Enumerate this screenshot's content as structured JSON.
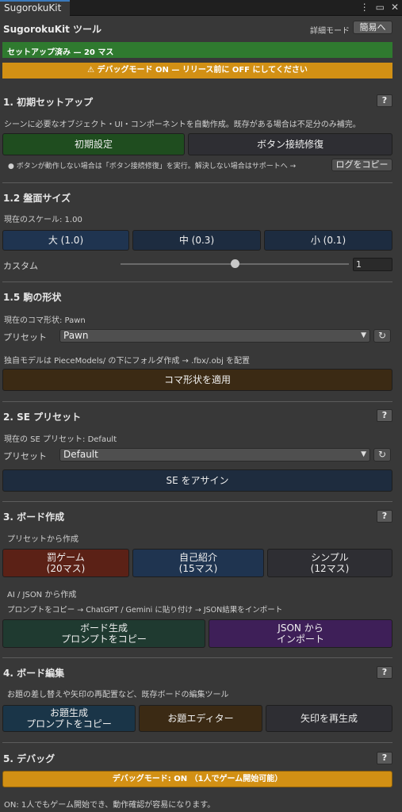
{
  "tab": {
    "title": "SugorokuKit"
  },
  "header": {
    "title": "SugorokuKit ツール",
    "detail_mode_label": "詳細モード",
    "simple_button": "簡易へ"
  },
  "status": {
    "setup_text": "セットアップ済み — 20 マス",
    "debug_warning": "⚠ デバッグモード ON — リリース前に OFF にしてください"
  },
  "sections": {
    "setup": {
      "title": "1. 初期セットアップ",
      "help": "?",
      "description": "シーンに必要なオブジェクト・UI・コンポーネントを自動作成。既存がある場合は不足分のみ補完。",
      "init_button": "初期設定",
      "repair_button": "ボタン接続修復",
      "tip": "● ボタンが動作しない場合は「ボタン接続修復」を実行。解決しない場合はサポートへ →",
      "copy_log_button": "ログをコピー"
    },
    "board_size": {
      "title": "1.2 盤面サイズ",
      "current_scale": "現在のスケール: 1.00",
      "large_button": "大 (1.0)",
      "medium_button": "中 (0.3)",
      "small_button": "小 (0.1)",
      "custom_label": "カスタム",
      "custom_value": "1",
      "slider_fraction": 0.5
    },
    "piece_shape": {
      "title": "1.5 駒の形状",
      "current_shape": "現在のコマ形状: Pawn",
      "preset_label": "プリセット",
      "preset_value": "Pawn",
      "custom_model_note": "独自モデルは PieceModels/ の下にフォルダ作成 → .fbx/.obj を配置",
      "apply_button": "コマ形状を適用"
    },
    "se_preset": {
      "title": "2. SE プリセット",
      "help": "?",
      "current_se": "現在の SE プリセット: Default",
      "preset_label": "プリセット",
      "preset_value": "Default",
      "assign_button": "SE をアサイン"
    },
    "board_create": {
      "title": "3. ボード作成",
      "help": "?",
      "from_preset_label": "プリセットから作成",
      "penalty_button_line1": "罰ゲーム",
      "penalty_button_line2": "(20マス)",
      "intro_button_line1": "自己紹介",
      "intro_button_line2": "(15マス)",
      "simple_button_line1": "シンプル",
      "simple_button_line2": "(12マス)",
      "ai_json_label": "AI / JSON から作成",
      "ai_json_note": "プロンプトをコピー → ChatGPT / Gemini に貼り付け → JSON結果をインポート",
      "prompt_button_line1": "ボード生成",
      "prompt_button_line2": "プロンプトをコピー",
      "import_button_line1": "JSON から",
      "import_button_line2": "インポート"
    },
    "board_edit": {
      "title": "4. ボード編集",
      "help": "?",
      "description": "お題の差し替えや矢印の再配置など、既存ボードの編集ツール",
      "topic_prompt_line1": "お題生成",
      "topic_prompt_line2": "プロンプトをコピー",
      "topic_editor_button": "お題エディター",
      "regen_arrows_button": "矢印を再生成"
    },
    "debug": {
      "title": "5. デバッグ",
      "help": "?",
      "debug_toggle": "デバッグモード: ON （1人でゲーム開始可能）",
      "note": "ON: 1人でもゲーム開始でき、動作確認が容易になります。"
    }
  },
  "colors": {
    "status_green": "#2f7a2f",
    "debug_orange": "#d29014",
    "tab_accent": "#3a79bb"
  }
}
